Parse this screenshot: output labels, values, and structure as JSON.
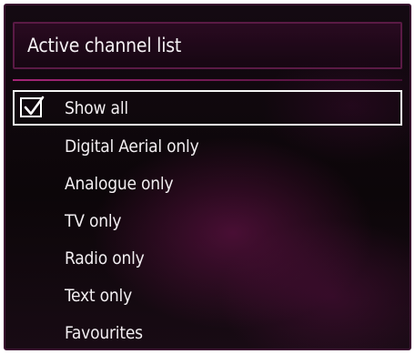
{
  "menu": {
    "title": "Active channel list",
    "items": [
      {
        "label": "Show all",
        "checked": true,
        "selected": true,
        "icon": "checkmark-icon"
      },
      {
        "label": "Digital Aerial only",
        "checked": false,
        "selected": false
      },
      {
        "label": "Analogue only",
        "checked": false,
        "selected": false
      },
      {
        "label": "TV only",
        "checked": false,
        "selected": false
      },
      {
        "label": "Radio only",
        "checked": false,
        "selected": false
      },
      {
        "label": "Text only",
        "checked": false,
        "selected": false
      },
      {
        "label": "Favourites",
        "checked": false,
        "selected": false
      }
    ]
  },
  "colors": {
    "accent": "#b4288c",
    "selection_border": "#f5f5f5",
    "text": "#f2eef1",
    "background": "#0c0609"
  }
}
